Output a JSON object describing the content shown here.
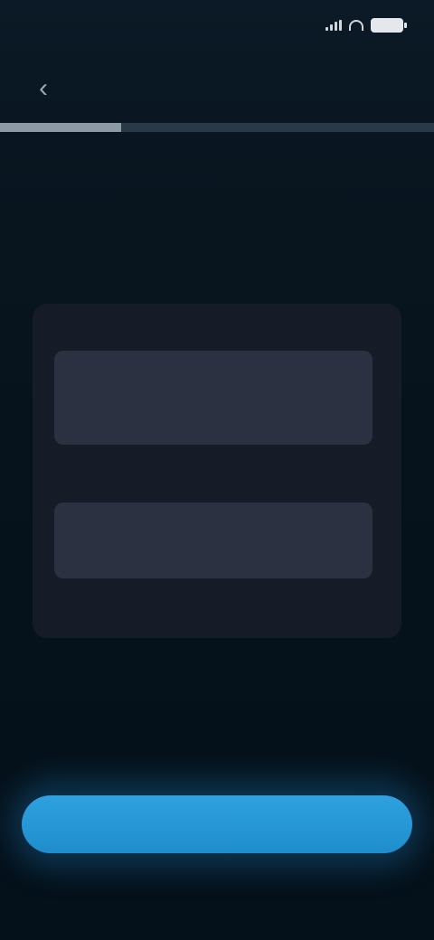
{
  "status_bar": {
    "time": "",
    "battery_level": 1.0
  },
  "nav": {
    "title": ""
  },
  "progress": {
    "fraction": 0.28
  },
  "heading": {
    "step": "",
    "title": ""
  },
  "description": "",
  "form": {
    "field1": {
      "label": "",
      "value": "",
      "char_count": ""
    },
    "field2": {
      "label": "",
      "value": ""
    },
    "link_label": ""
  },
  "helper_link": "",
  "primary_button": {
    "label": ""
  },
  "colors": {
    "background": "#061019",
    "accent": "#1f8dcc",
    "field_label": "#d05d4e",
    "link": "#3c84b5"
  },
  "icons": [
    "chevron-left-icon",
    "signal-icon",
    "wifi-icon",
    "battery-icon"
  ]
}
